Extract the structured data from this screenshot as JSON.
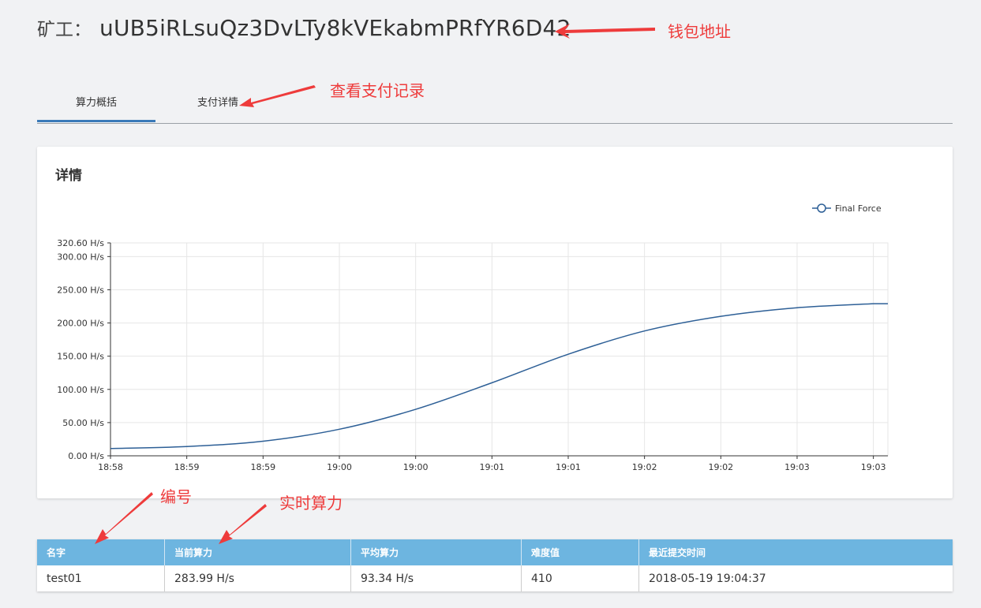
{
  "header": {
    "miner_label": "矿工：",
    "wallet_address": "uUB5iRLsuQz3DvLTy8kVEkabmPRfYR6D42"
  },
  "annotations": {
    "wallet": "钱包地址",
    "payment": "查看支付记录",
    "number": "编号",
    "realtime": "实时算力",
    "color": "#ee3b3b"
  },
  "tabs": [
    {
      "label": "算力概括",
      "active": true
    },
    {
      "label": "支付详情",
      "active": false
    }
  ],
  "card": {
    "title": "详情"
  },
  "chart_data": {
    "type": "line",
    "x": [
      "18:58",
      "18:59",
      "18:59",
      "19:00",
      "19:00",
      "19:01",
      "19:01",
      "19:02",
      "19:02",
      "19:03",
      "19:03"
    ],
    "y_ticks": [
      "0.00 H/s",
      "50.00 H/s",
      "100.00 H/s",
      "150.00 H/s",
      "200.00 H/s",
      "250.00 H/s",
      "300.00 H/s",
      "320.60 H/s"
    ],
    "ylim": [
      0,
      320.6
    ],
    "grid": true,
    "legend_position": "top-right",
    "series": [
      {
        "name": "Final Force",
        "color": "#2d5f96",
        "values": [
          11,
          14,
          22,
          40,
          70,
          110,
          153,
          188,
          210,
          223,
          229
        ]
      }
    ]
  },
  "table": {
    "headers": [
      "名字",
      "当前算力",
      "平均算力",
      "难度值",
      "最近提交时间"
    ],
    "rows": [
      [
        "test01",
        "283.99 H/s",
        "93.34 H/s",
        "410",
        "2018-05-19 19:04:37"
      ]
    ],
    "header_color": "#6db5e0"
  }
}
